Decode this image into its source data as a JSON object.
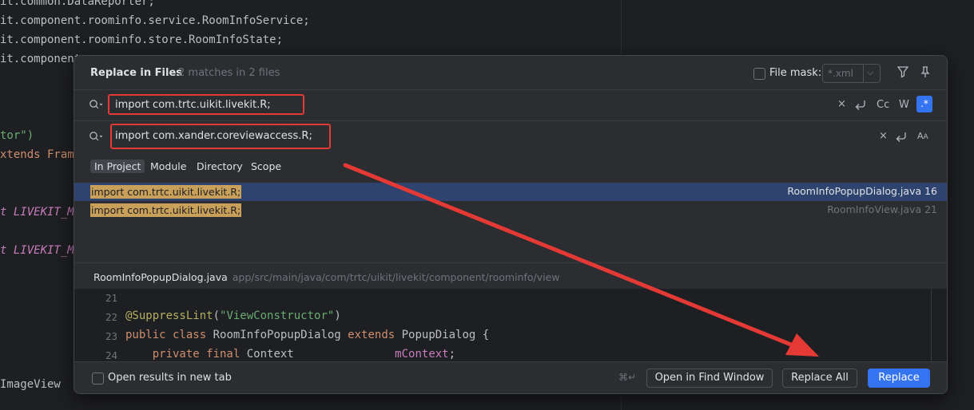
{
  "background_editor": {
    "lines": [
      {
        "text": "it.common.DataReporter;"
      },
      {
        "text": "it.component.roominfo.service.RoomInfoService;"
      },
      {
        "text": "it.component.roominfo.store.RoomInfoState;"
      },
      {
        "text": "it.component"
      },
      {
        "text": "tor\")"
      },
      {
        "text": "xtends Frame"
      },
      {
        "text": "t LIVEKIT_MA"
      },
      {
        "text": "t LIVEKIT_MA"
      },
      {
        "text": "ImageView"
      }
    ]
  },
  "dialog": {
    "title": "Replace in Files",
    "subtitle": "2 matches in 2 files",
    "file_mask": {
      "label": "File mask:",
      "placeholder": "*.xml",
      "checked": false
    },
    "search_field": {
      "value": "import com.trtc.uikit.livekit.R;"
    },
    "search_toggles": {
      "match_case": "Cc",
      "words": "W",
      "regex": ".*"
    },
    "replace_field": {
      "value": "import com.xander.coreviewaccess.R;"
    },
    "scope_tabs": [
      {
        "label": "In Project",
        "active": true
      },
      {
        "label": "Module",
        "active": false
      },
      {
        "label": "Directory",
        "active": false
      },
      {
        "label": "Scope",
        "active": false
      }
    ],
    "results": [
      {
        "match": "import com.trtc.uikit.livekit.R;",
        "file": "RoomInfoPopupDialog.java 16",
        "selected": true
      },
      {
        "match": "import com.trtc.uikit.livekit.R;",
        "file": "RoomInfoView.java 21",
        "selected": false
      }
    ],
    "preview": {
      "file_name": "RoomInfoPopupDialog.java",
      "file_path": "app/src/main/java/com/trtc/uikit/livekit/component/roominfo/view",
      "lines": [
        {
          "num": "21"
        },
        {
          "num": "22",
          "annotation": "@SuppressLint",
          "paren_open": "(",
          "string": "\"ViewConstructor\"",
          "paren_close": ")"
        },
        {
          "num": "23",
          "kw1": "public class",
          "name": " RoomInfoPopupDialog ",
          "kw2": "extends",
          "rest": " PopupDialog {"
        },
        {
          "num": "24",
          "kw": "    private final",
          "type": " Context               ",
          "field": "mContext",
          "end": ";"
        }
      ]
    },
    "footer": {
      "open_new_tab_label": "Open results in new tab",
      "open_new_tab_checked": false,
      "shortcut": "⌘↵",
      "buttons": {
        "open_in_find_window": "Open in Find Window",
        "replace_all": "Replace All",
        "replace": "Replace"
      }
    }
  },
  "colors": {
    "accent_blue": "#3574f0",
    "selection": "#2e436e",
    "match_highlight": "#c9a05a",
    "annotation_red": "#e53935"
  }
}
